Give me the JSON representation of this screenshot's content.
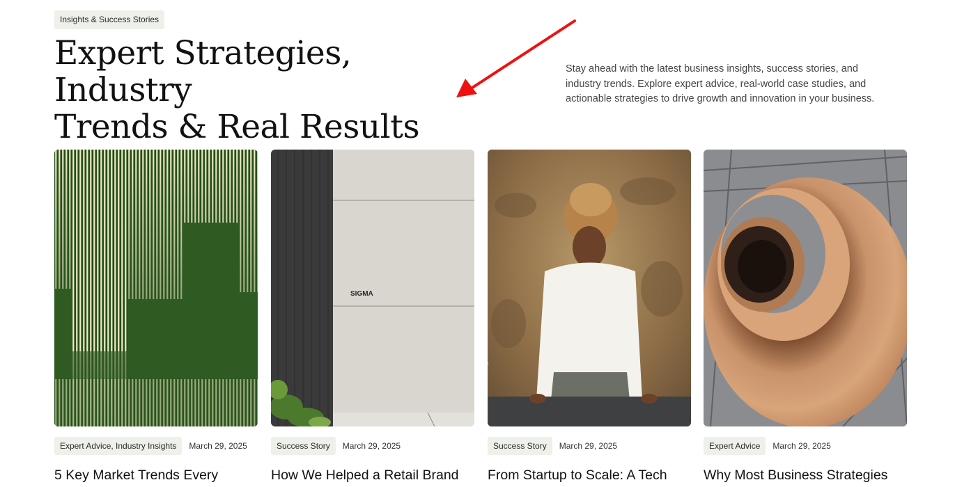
{
  "eyebrow": "Insights & Success Stories",
  "hero": {
    "title_line1": "Expert Strategies, Industry",
    "title_line2": "Trends & Real Results",
    "description": "Stay ahead with the latest business insights, success stories, and industry trends. Explore expert advice, real-world case studies, and actionable strategies to drive growth and innovation in your business."
  },
  "annotation": {
    "arrow_color": "#ee1111"
  },
  "cards": [
    {
      "tag": "Expert Advice, Industry Insights",
      "date": "March 29, 2025",
      "title": "5 Key Market Trends Every",
      "image": "green-vertical-stripes"
    },
    {
      "tag": "Success Story",
      "date": "March 29, 2025",
      "title": "How We Helped a Retail Brand",
      "image": "sigma-building-wall",
      "image_text": "SIGMA"
    },
    {
      "tag": "Success Story",
      "date": "March 29, 2025",
      "title": "From Startup to Scale: A Tech",
      "image": "smiling-woman-at-desk"
    },
    {
      "tag": "Expert Advice",
      "date": "March 29, 2025",
      "title": "Why Most Business Strategies",
      "image": "spiral-staircase"
    }
  ]
}
